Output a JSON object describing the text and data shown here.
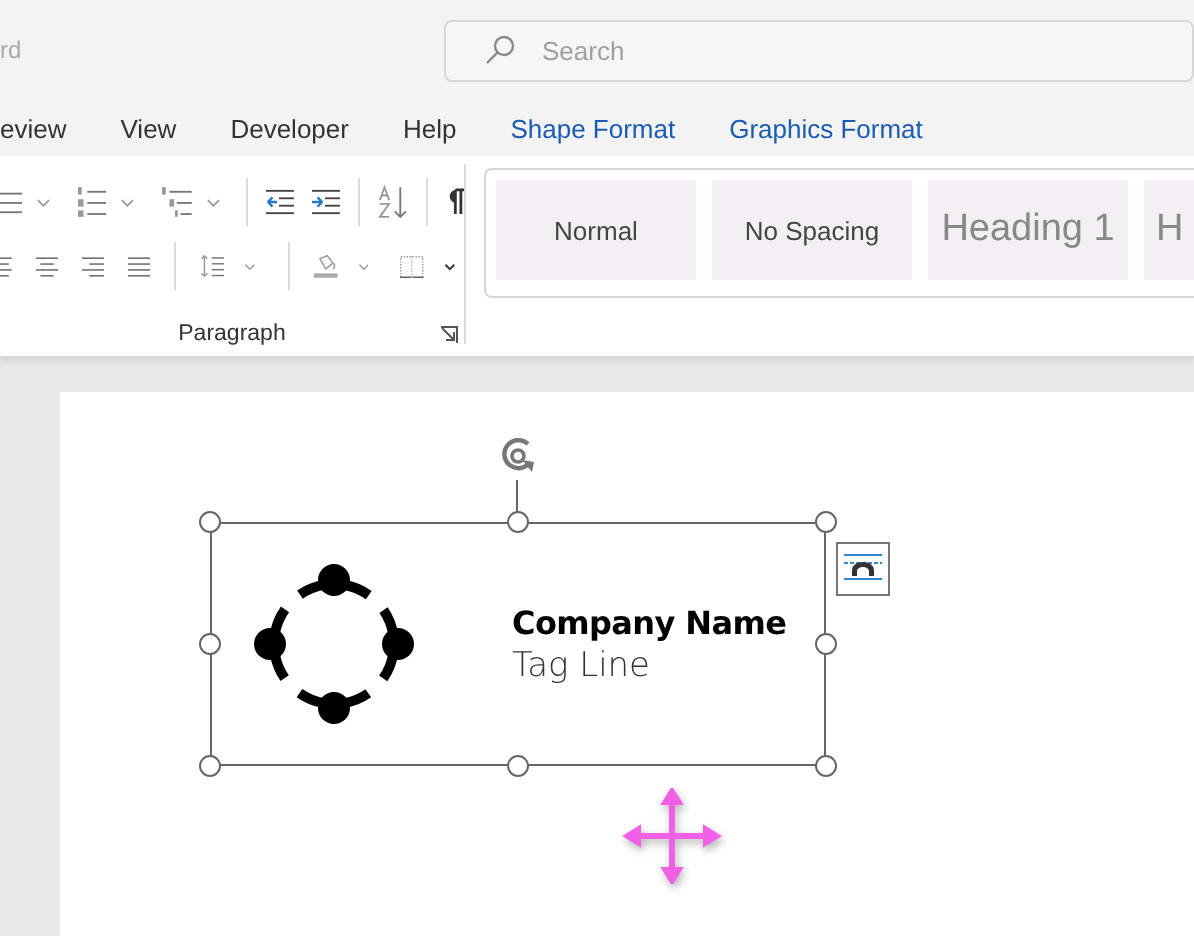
{
  "window": {
    "title": "rd"
  },
  "search": {
    "placeholder": "Search"
  },
  "tabs": [
    {
      "label": "eview",
      "kind": "standard"
    },
    {
      "label": "View",
      "kind": "standard"
    },
    {
      "label": "Developer",
      "kind": "standard"
    },
    {
      "label": "Help",
      "kind": "standard"
    },
    {
      "label": "Shape Format",
      "kind": "contextual"
    },
    {
      "label": "Graphics Format",
      "kind": "contextual"
    }
  ],
  "paragraph_group": {
    "label": "Paragraph"
  },
  "styles": [
    {
      "label": "Normal",
      "kind": "body"
    },
    {
      "label": "No Spacing",
      "kind": "body"
    },
    {
      "label": "Heading 1",
      "kind": "heading"
    },
    {
      "label": "H",
      "kind": "heading"
    }
  ],
  "shape": {
    "company_name": "Company Name",
    "tag_line": "Tag Line"
  }
}
